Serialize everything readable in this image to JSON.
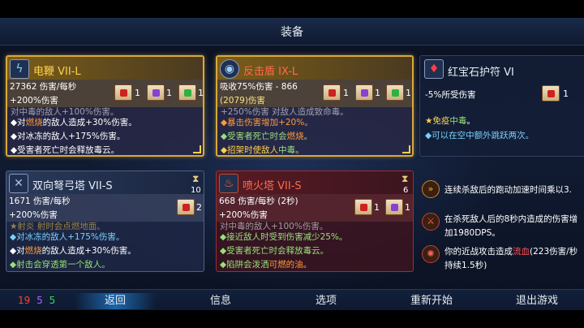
{
  "header": {
    "title": "装备"
  },
  "cards": {
    "whip": {
      "name": "电鞭 VII-L",
      "stat1": "27362 伤害/每秒",
      "stat2": "+200%伤害",
      "clipped": "对中毒的敌人+100%伤害。",
      "lines": [
        {
          "pre": "◆对",
          "hl": "燃烧",
          "post": "的敌人造成+30%伤害。",
          "hlc": "o"
        },
        {
          "pre": "◆对冰冻的敌人+175%伤害。",
          "hl": "",
          "post": "",
          "hlc": "c"
        },
        {
          "pre": "◆受害者死亡时会释放毒云。",
          "hl": "",
          "post": "",
          "hlc": "y"
        }
      ],
      "scrolls": [
        "1",
        "1",
        "1"
      ]
    },
    "shield": {
      "name": "反击盾 IX-L",
      "stat1": "吸收75%伤害 - 866",
      "stat1b": "(2079)伤害",
      "stat2": "+250%伤害",
      "clipped": "+250%伤害 对敌人造成致命毒。",
      "lines": [
        {
          "pre": "◆暴击伤害增加+20%。",
          "hl": "",
          "post": "",
          "hlc": "o"
        },
        {
          "pre": "◆受害者死亡时会",
          "hl": "燃烧",
          "post": "。",
          "hlc": "o"
        },
        {
          "pre": "◆招架时使敌人",
          "hl": "中毒",
          "post": "。",
          "hlc": "g"
        }
      ],
      "scrolls": [
        "1",
        "1",
        "1"
      ]
    },
    "amulet": {
      "name": "红宝石护符 VI",
      "stat1": "-5%所受伤害",
      "lines": [
        {
          "pre": "★免疫",
          "hl": "中毒",
          "post": "。",
          "hlc": "g"
        },
        {
          "pre": "◆可以在空中额外跳跃两次。",
          "hl": "",
          "post": "",
          "hlc": "c"
        }
      ],
      "scrolls": [
        "1"
      ]
    },
    "crossbow": {
      "name": "双向弩弓塔 VII-S",
      "stat1": "1671 伤害/每秒",
      "stat2": "+200%伤害",
      "timer": "10",
      "clipped": "★射炎 射时会点燃地面。",
      "lines": [
        {
          "pre": "◆对冰冻的敌人+175%伤害。",
          "hl": "",
          "post": "",
          "hlc": "c"
        },
        {
          "pre": "◆对",
          "hl": "燃烧",
          "post": "的敌人造成+30%伤害。",
          "hlc": "o"
        },
        {
          "pre": "◆射击会穿透第一个敌人。",
          "hl": "",
          "post": "",
          "hlc": "g"
        }
      ],
      "scrolls": [
        "2"
      ]
    },
    "flamethrower": {
      "name": "喷火塔 VII-S",
      "stat1": "668 伤害/每秒 (2秒)",
      "stat2": "+200%伤害",
      "timer": "6",
      "clipped": "对中毒的敌人+100%伤害。",
      "lines": [
        {
          "pre": "◆接近敌人时受到伤害减少25%。",
          "hl": "",
          "post": "",
          "hlc": "c"
        },
        {
          "pre": "◆受害者死亡时会释放毒云。",
          "hl": "",
          "post": "",
          "hlc": "y"
        },
        {
          "pre": "◆陷阱会泼洒",
          "hl": "可燃的油",
          "post": "。",
          "hlc": "o"
        }
      ],
      "scrolls": [
        "1",
        "1"
      ]
    }
  },
  "perks": [
    {
      "line1": "连续杀敌后的跑动加速时间乘以3.",
      "line2": ""
    },
    {
      "line1": "在杀死敌人后的8秒内造成的伤害增",
      "line2": "加1980DPS。"
    },
    {
      "line1pre": "你的近战攻击造成",
      "line1hl": "流血",
      "line1post": "(223伤害/秒",
      "line2": "持续1.5秒)"
    }
  ],
  "footer": {
    "stat_red": "19",
    "stat_purple": "5",
    "stat_green": "5",
    "buttons": [
      "返回",
      "信息",
      "选项",
      "重新开始",
      "退出游戏"
    ]
  },
  "colors": {
    "gold": "#d8a93a",
    "red_border": "#9a3030",
    "scroll_red": "#d02020",
    "scroll_purple": "#8a40d0",
    "scroll_green": "#30b040"
  }
}
